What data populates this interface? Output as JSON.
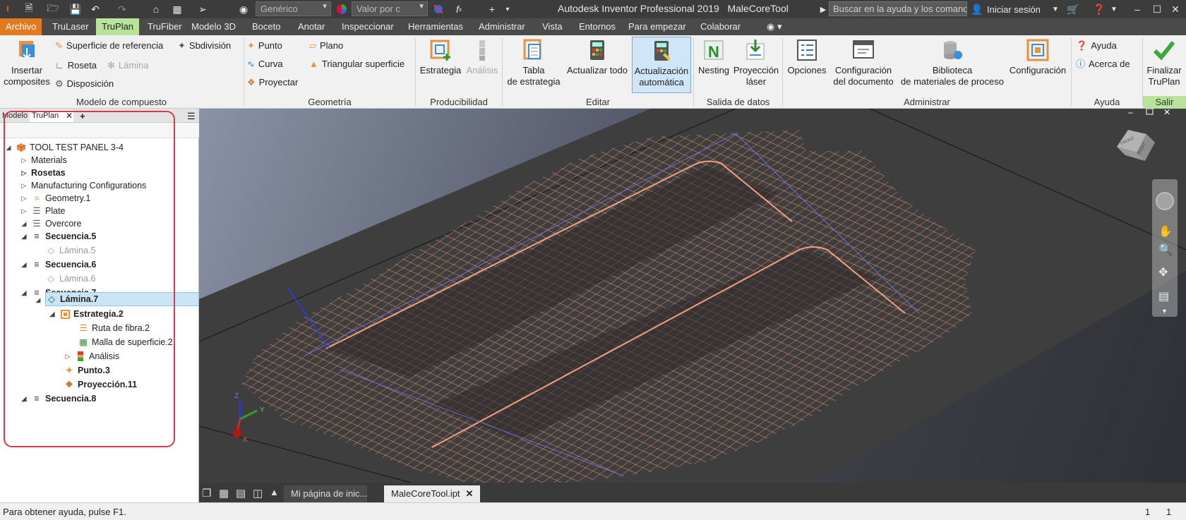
{
  "titlebar": {
    "style_combo": "Genérico",
    "appearance_combo": "Valor por c",
    "app_title": "Autodesk Inventor Professional 2019",
    "doc_title": "MaleCoreTool",
    "search_placeholder": "Buscar en la ayuda y los comand",
    "signin": "Iniciar sesión"
  },
  "ribbon_tabs": [
    {
      "label": "Archivo"
    },
    {
      "label": "TruLaser"
    },
    {
      "label": "TruPlan"
    },
    {
      "label": "TruFiber"
    },
    {
      "label": "Modelo 3D"
    },
    {
      "label": "Boceto"
    },
    {
      "label": "Anotar"
    },
    {
      "label": "Inspeccionar"
    },
    {
      "label": "Herramientas"
    },
    {
      "label": "Administrar"
    },
    {
      "label": "Vista"
    },
    {
      "label": "Entornos"
    },
    {
      "label": "Para empezar"
    },
    {
      "label": "Colaborar"
    }
  ],
  "ribbon": {
    "insertar": "Insertar\ncomposites",
    "superficie_ref": "Superficie de referencia",
    "sbdivision": "Sbdivisión",
    "roseta": "Roseta",
    "lamina": "Lámina",
    "disposicion": "Disposición",
    "modelo_title": "Modelo de compuesto",
    "punto": "Punto",
    "plano": "Plano",
    "curva": "Curva",
    "triangular": "Triangular superficie",
    "proyectar": "Proyectar",
    "geometria_title": "Geometría",
    "estrategia": "Estrategia",
    "analisis": "Análisis",
    "producibilidad_title": "Producibilidad",
    "tabla1": "Tabla",
    "tabla2": "de estrategia",
    "actualizar_todo": "Actualizar todo",
    "actualizacion1": "Actualización",
    "actualizacion2": "automática",
    "editar_title": "Editar",
    "nesting": "Nesting",
    "proyeccion1": "Proyección",
    "proyeccion2": "láser",
    "salida_title": "Salida de datos",
    "opciones": "Opciones",
    "config_doc1": "Configuración",
    "config_doc2": "del documento",
    "biblioteca1": "Biblioteca",
    "biblioteca2": "de materiales de proceso",
    "configuracion": "Configuración",
    "administrar_title": "Administrar",
    "ayuda": "Ayuda",
    "acerca": "Acerca de",
    "ayuda_title": "Ayuda",
    "finalizar1": "Finalizar",
    "finalizar2": "TruPlan",
    "salir_title": "Salir"
  },
  "browser": {
    "tab_modelo": "Modelo",
    "tab_truplan": "TruPlan",
    "tree": [
      {
        "label": "TOOL TEST PANEL 3-4"
      },
      {
        "label": "Materials"
      },
      {
        "label": "Rosetas"
      },
      {
        "label": "Manufacturing Configurations"
      },
      {
        "label": "Geometry.1"
      },
      {
        "label": "Plate"
      },
      {
        "label": "Overcore"
      },
      {
        "label": "Secuencia.5"
      },
      {
        "label": "Lámina.5"
      },
      {
        "label": "Secuencia.6"
      },
      {
        "label": "Lámina.6"
      },
      {
        "label": "Secuencia.7"
      },
      {
        "label": "Lámina.7"
      },
      {
        "label": "Estrategia.2"
      },
      {
        "label": "Ruta de fibra.2"
      },
      {
        "label": "Malla de superficie.2"
      },
      {
        "label": "Análisis"
      },
      {
        "label": "Punto.3"
      },
      {
        "label": "Proyección.11"
      },
      {
        "label": "Secuencia.8"
      }
    ]
  },
  "viewcube_labels": {
    "front": "FRONT",
    "right": "RIGHT"
  },
  "axes": {
    "x": "X",
    "y": "Y",
    "z": "Z"
  },
  "doctabs": {
    "home": "Mi página de inic...",
    "active": "MaleCoreTool.ipt"
  },
  "status": {
    "help": "Para obtener ayuda, pulse F1.",
    "n1": "1",
    "n2": "1"
  },
  "colors": {
    "accent_orange": "#e07a1f",
    "truplan_green": "#b9e39a",
    "mesh": "#e8916e",
    "highlight": "#d9374c"
  }
}
